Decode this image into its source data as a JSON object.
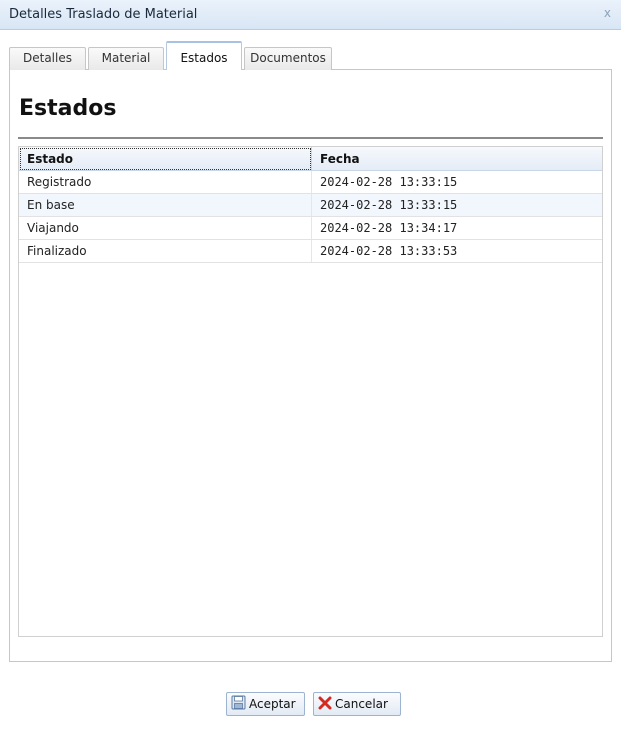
{
  "window": {
    "title": "Detalles Traslado de Material",
    "close_glyph": "x"
  },
  "tabs": [
    {
      "label": "Detalles",
      "active": false
    },
    {
      "label": "Material",
      "active": false
    },
    {
      "label": "Estados",
      "active": true
    },
    {
      "label": "Documentos",
      "active": false
    }
  ],
  "section": {
    "heading": "Estados"
  },
  "grid": {
    "columns": [
      "Estado",
      "Fecha"
    ],
    "rows": [
      {
        "estado": "Registrado",
        "fecha": "2024-02-28 13:33:15"
      },
      {
        "estado": "En base",
        "fecha": "2024-02-28 13:33:15"
      },
      {
        "estado": "Viajando",
        "fecha": "2024-02-28 13:34:17"
      },
      {
        "estado": "Finalizado",
        "fecha": "2024-02-28 13:33:53"
      }
    ]
  },
  "buttons": {
    "accept": {
      "label": "Aceptar",
      "icon": "save-icon"
    },
    "cancel": {
      "label": "Cancelar",
      "icon": "x-icon"
    }
  },
  "colors": {
    "accent_blue": "#a8c3e2",
    "cancel_red": "#d42a1f"
  }
}
